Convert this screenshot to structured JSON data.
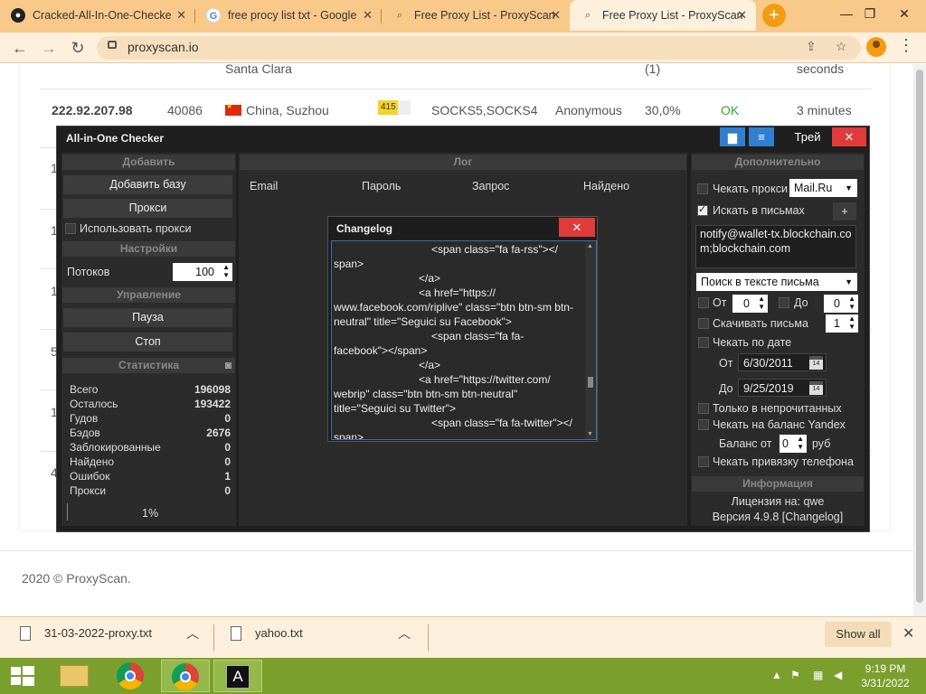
{
  "browser": {
    "tabs": [
      {
        "title": "Cracked-All-In-One-Checke",
        "icon": "github-icon"
      },
      {
        "title": "free procy list txt - Google",
        "icon": "google-icon"
      },
      {
        "title": "Free Proxy List - ProxyScan",
        "icon": "proxyscan-icon"
      },
      {
        "title": "Free Proxy List - ProxyScan",
        "icon": "proxyscan-icon"
      }
    ],
    "url": "proxyscan.io"
  },
  "page": {
    "row_top": {
      "city": "Santa Clara",
      "count": "(1)",
      "time": "seconds"
    },
    "row_main": {
      "ip": "222.92.207.98",
      "port": "40086",
      "location": "China, Suzhou",
      "ping": "415",
      "type": "SOCKS5,SOCKS4",
      "anonymity": "Anonymous",
      "uptime": "30,0%",
      "status": "OK",
      "checked": "3 minutes"
    },
    "left_digits": [
      "1",
      "1",
      "1",
      "5",
      "1",
      "4"
    ],
    "footer": "2020 © ProxyScan."
  },
  "app": {
    "title": "All-in-One Checker",
    "tray_label": "Трей",
    "close": "✕",
    "left": {
      "add_header": "Добавить",
      "add_base": "Добавить базу",
      "proxy": "Прокси",
      "use_proxy": "Использовать прокси",
      "settings_header": "Настройки",
      "threads_label": "Потоков",
      "threads_value": "100",
      "control_header": "Управление",
      "pause": "Пауза",
      "stop": "Стоп",
      "stats_header": "Статистика",
      "stats": [
        {
          "label": "Всего",
          "value": "196098"
        },
        {
          "label": "Осталось",
          "value": "193422"
        },
        {
          "label": "Гудов",
          "value": "0"
        },
        {
          "label": "Бэдов",
          "value": "2676"
        },
        {
          "label": "Заблокированные",
          "value": "0"
        },
        {
          "label": "Найдено",
          "value": "0"
        },
        {
          "label": "Ошибок",
          "value": "1"
        },
        {
          "label": "Прокси",
          "value": "0"
        }
      ],
      "progress": "1%"
    },
    "log": {
      "header": "Лог",
      "columns": [
        "Email",
        "Пароль",
        "Запрос",
        "Найдено"
      ]
    },
    "right": {
      "header": "Дополнительно",
      "check_proxy": "Чекать прокси",
      "proxy_provider": "Mail.Ru",
      "search_in_letters": "Искать в письмах",
      "plus": "+",
      "search_text": "notify@wallet-tx.blockchain.com;blockchain.com",
      "search_mode": "Поиск в тексте письма",
      "from_label": "От",
      "from_value": "0",
      "to_label": "До",
      "to_value": "0",
      "download_letters": "Скачивать письма",
      "download_value": "1",
      "check_by_date": "Чекать по дате",
      "date_from_label": "От",
      "date_from": "6/30/2011",
      "date_to_label": "До",
      "date_to": "9/25/2019",
      "unread_only": "Только в непрочитанных",
      "check_yandex": "Чекать на баланс Yandex",
      "balance_from": "Баланс от",
      "balance_value": "0",
      "currency": "руб",
      "check_phone": "Чекать привязку телефона",
      "info_header": "Информация",
      "license": "Лицензия на: qwe",
      "version": "Версия 4.9.8 [Changelog]"
    },
    "changelog": {
      "title": "Changelog",
      "close": "✕",
      "lines": [
        "<span class=\"fa fa-rss\"></",
        "span>",
        "</a>",
        "<a href=\"https://",
        "www.facebook.com/riplive\" class=\"btn btn-sm btn-",
        "neutral\" title=\"Seguici su Facebook\">",
        "<span class=\"fa fa-",
        "facebook\"></span>",
        "</a>",
        "<a href=\"https://twitter.com/",
        "webrip\" class=\"btn btn-sm btn-neutral\"",
        "title=\"Seguici su Twitter\">",
        "<span class=\"fa fa-twitter\"></",
        "span>"
      ]
    }
  },
  "downloads": {
    "items": [
      "31-03-2022-proxy.txt",
      "yahoo.txt"
    ],
    "show_all": "Show all"
  },
  "taskbar": {
    "time": "9:19 PM",
    "date": "3/31/2022",
    "active_app_letter": "A"
  }
}
